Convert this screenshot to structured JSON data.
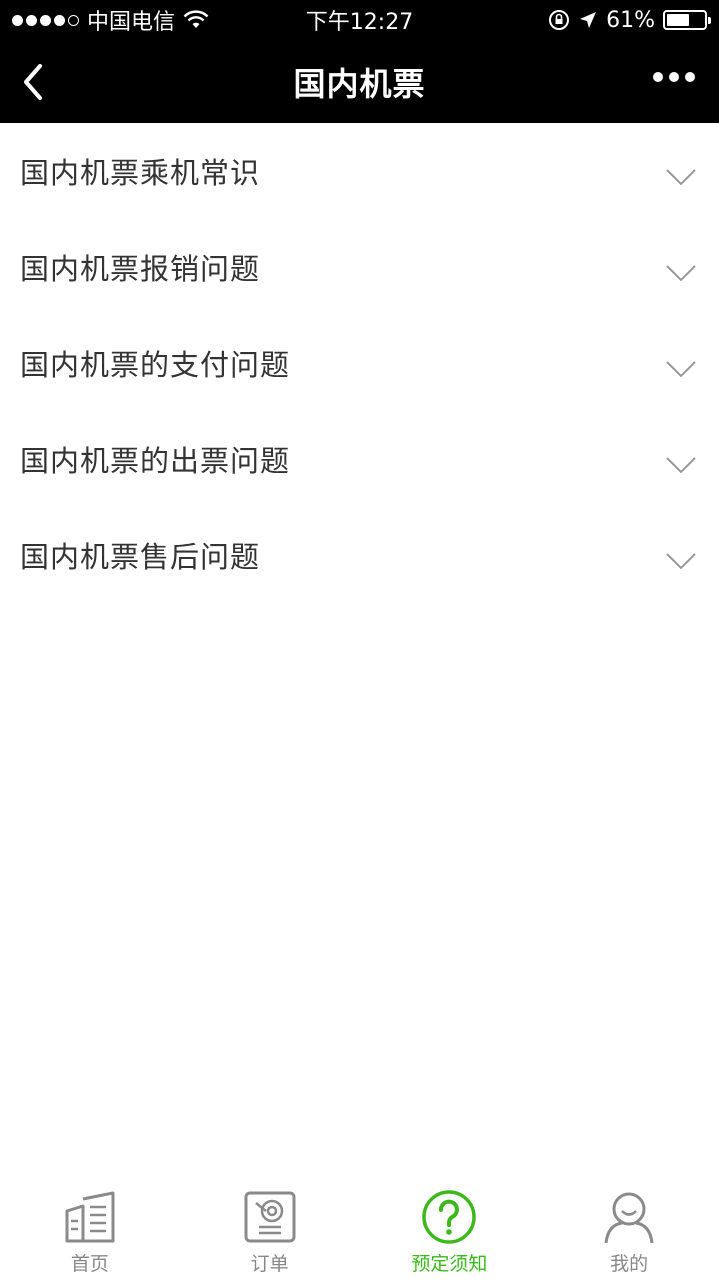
{
  "status_bar": {
    "carrier": "中国电信",
    "time": "下午12:27",
    "battery": "61%",
    "battery_level": 0.61
  },
  "nav": {
    "title": "国内机票"
  },
  "faq": {
    "items": [
      {
        "label": "国内机票乘机常识"
      },
      {
        "label": "国内机票报销问题"
      },
      {
        "label": "国内机票的支付问题"
      },
      {
        "label": "国内机票的出票问题"
      },
      {
        "label": "国内机票售后问题"
      }
    ]
  },
  "tabs": [
    {
      "label": "首页",
      "icon": "home-icon",
      "active": false
    },
    {
      "label": "订单",
      "icon": "order-icon",
      "active": false
    },
    {
      "label": "预定须知",
      "icon": "question-icon",
      "active": true
    },
    {
      "label": "我的",
      "icon": "user-icon",
      "active": false
    }
  ],
  "colors": {
    "accent": "#3cb81d",
    "header_bg": "#000000"
  }
}
